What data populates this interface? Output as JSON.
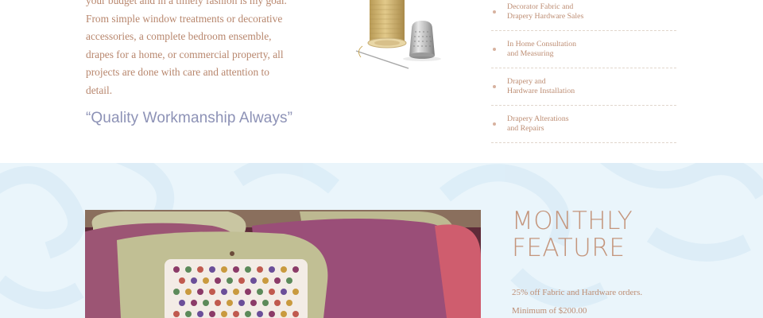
{
  "intro": {
    "text": "your budget and in a timely fashion is my goal.\nFrom simple window treatments or decorative\naccessories,  a complete bedroom ensemble,\ndrapes for a home, or commercial property, all\nprojects are done with care and attention to\ndetail."
  },
  "tagline": "“Quality Workmanship Always”",
  "services": [
    {
      "label": "Decorator Fabric and\nDrapery Hardware Sales"
    },
    {
      "label": "In Home Consultation\nand Measuring"
    },
    {
      "label": "Drapery and\nHardware Installation"
    },
    {
      "label": "Drapery Alterations\nand Repairs"
    }
  ],
  "feature": {
    "heading": "MONTHLY\nFEATURE",
    "offer": "25% off Fabric and Hardware orders.",
    "minimum": "Minimum of $200.00"
  },
  "colors": {
    "text_accent": "#b8876e",
    "tagline": "#8d92b6",
    "feature_bg": "#eaf5fb",
    "heading": "#c4957c"
  }
}
